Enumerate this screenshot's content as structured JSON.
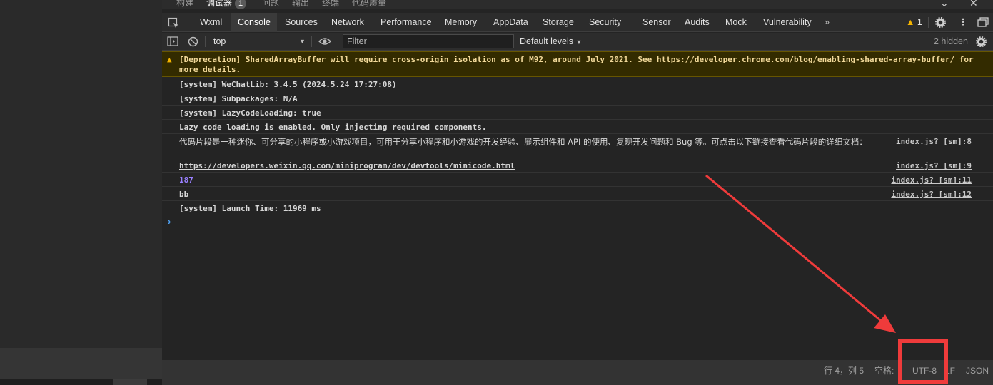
{
  "top_tabs": [
    {
      "label": "构建"
    },
    {
      "label": "调试器",
      "badge": "1"
    },
    {
      "label": "问题"
    },
    {
      "label": "输出"
    },
    {
      "label": "终端"
    },
    {
      "label": "代码质量"
    }
  ],
  "panel_tabs": [
    "Wxml",
    "Console",
    "Sources",
    "Network",
    "Performance",
    "Memory",
    "AppData",
    "Storage",
    "Security",
    "Sensor",
    "Audits",
    "Mock",
    "Vulnerability"
  ],
  "warning_count": "1",
  "toolbar": {
    "context": "top",
    "filter_placeholder": "Filter",
    "levels": "Default levels",
    "hidden": "2 hidden"
  },
  "console": {
    "warning": {
      "prefix": "[Deprecation] SharedArrayBuffer will require cross-origin isolation as of M92, around July 2021. See ",
      "link": "https://developer.chrome.com/blog/enabling-shared-array-buffer/",
      "suffix": " for more details."
    },
    "lines": [
      {
        "text": "[system] WeChatLib: 3.4.5 (2024.5.24 17:27:08)",
        "source": ""
      },
      {
        "text": "[system] Subpackages: N/A",
        "source": ""
      },
      {
        "text": "[system] LazyCodeLoading: true",
        "source": ""
      },
      {
        "text": "Lazy code loading is enabled. Only injecting required components.",
        "source": ""
      },
      {
        "text": "代码片段是一种迷你、可分享的小程序或小游戏项目，可用于分享小程序和小游戏的开发经验、展示组件和 API 的使用、复现开发问题和 Bug 等。可点击以下链接查看代码片段的详细文档：",
        "source": "index.js? [sm]:8"
      },
      {
        "text": "https://developers.weixin.qq.com/miniprogram/dev/devtools/minicode.html",
        "source": "index.js? [sm]:9"
      },
      {
        "text": "187",
        "source": "index.js? [sm]:11"
      },
      {
        "text": "bb",
        "source": "index.js? [sm]:12"
      },
      {
        "text": "[system] Launch Time: 11969 ms",
        "source": ""
      }
    ]
  },
  "statusbar": {
    "position": "行 4，列 5",
    "spaces": "空格:",
    "encoding": "UTF-8",
    "eol": "LF",
    "language": "JSON"
  },
  "colors": {
    "highlight": "#ef3b3b",
    "warning_bg": "#332b00",
    "number": "#9980ff"
  }
}
